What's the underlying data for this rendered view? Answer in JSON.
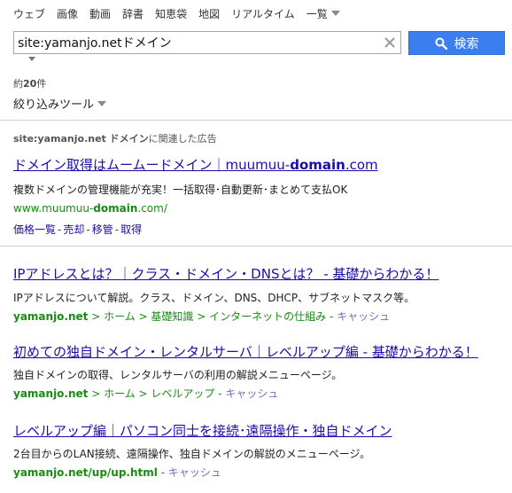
{
  "tabs": [
    "ウェブ",
    "画像",
    "動画",
    "辞書",
    "知恵袋",
    "地図",
    "リアルタイム"
  ],
  "tabs_more": "一覧",
  "search": {
    "value": "site:yamanjo.netドメイン",
    "button_label": "検索"
  },
  "result_count": {
    "prefix": "約",
    "number": "20",
    "suffix": "件"
  },
  "filter_label": "絞り込みツール",
  "ad": {
    "header_query": "site:yamanjo.net ドメイン",
    "header_suffix": "に関連した広告",
    "title_a": "ドメイン取得はムームードメイン｜muumuu-",
    "title_b": "domain",
    "title_c": ".com",
    "desc": "複数ドメインの管理機能が充実！一括取得･自動更新･まとめて支払OK",
    "url_a": "www.muumuu-",
    "url_b": "domain",
    "url_c": ".com/",
    "sitelinks": [
      "価格一覧",
      "売却",
      "移管",
      "取得"
    ]
  },
  "results": [
    {
      "title": "IPアドレスとは？｜クラス・ドメイン・DNSとは？ - 基礎からわかる！",
      "desc": "IPアドレスについて解説。クラス、ドメイン、DNS、DHCP、サブネットマスク等。",
      "host": "yamanjo.net",
      "crumbs": [
        "ホーム",
        "基礎知識",
        "インターネットの仕組み"
      ],
      "cache": "キャッシュ"
    },
    {
      "title": "初めての独自ドメイン・レンタルサーバ｜レベルアップ編 - 基礎からわかる！",
      "desc": "独自ドメインの取得、レンタルサーバの利用の解説メニューページ。",
      "host": "yamanjo.net",
      "crumbs": [
        "ホーム",
        "レベルアップ"
      ],
      "cache": "キャッシュ"
    },
    {
      "title": "レベルアップ編｜パソコン同士を接続･遠隔操作・独自ドメイン",
      "desc": "2台目からのLAN接続、遠隔操作、独自ドメインの解説のメニューページ。",
      "host": "yamanjo.net/up/up.html",
      "crumbs": [],
      "cache": "キャッシュ"
    }
  ]
}
